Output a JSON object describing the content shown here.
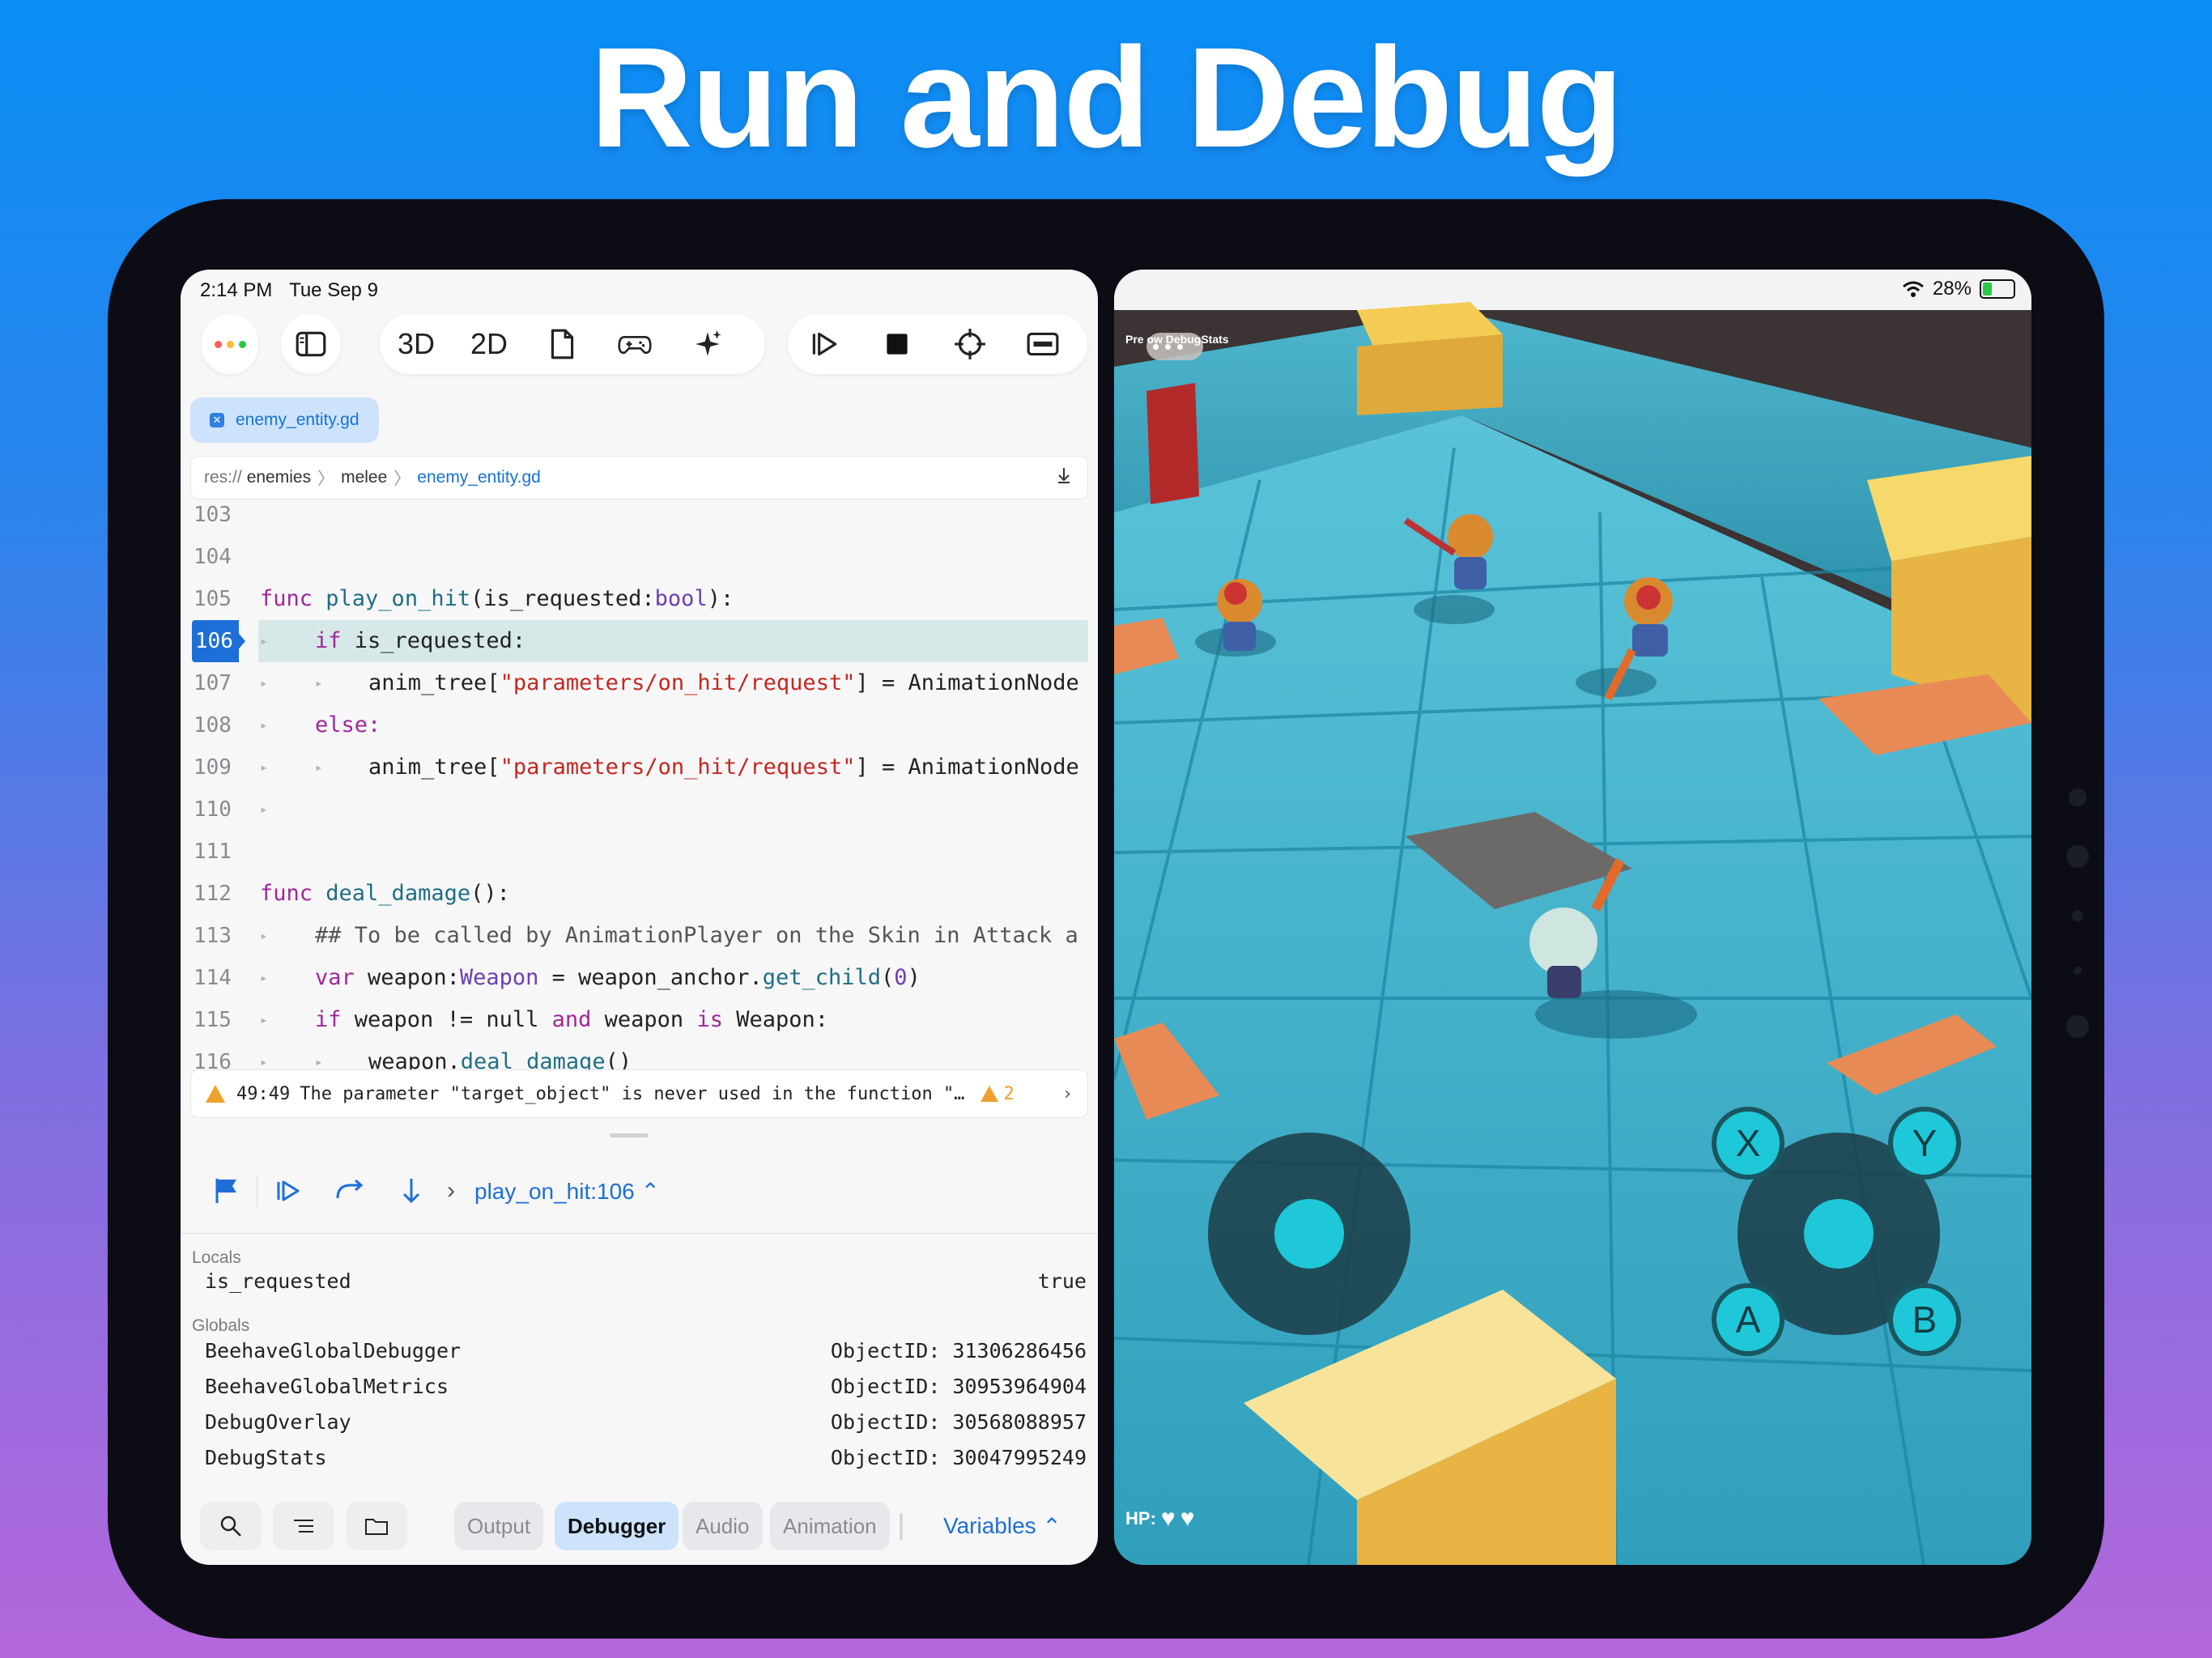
{
  "headline": "Run and Debug",
  "left_status": {
    "time": "2:14 PM",
    "date": "Tue Sep 9"
  },
  "right_status": {
    "battery": "28%"
  },
  "toolbar": {
    "btn_3d": "3D",
    "btn_2d": "2D"
  },
  "tab": {
    "label": "enemy_entity.gd"
  },
  "breadcrumb": {
    "root": "res://",
    "p1": "enemies",
    "p2": "melee",
    "file": "enemy_entity.gd"
  },
  "code": {
    "lines": [
      {
        "no": "103"
      },
      {
        "no": "104"
      },
      {
        "no": "105"
      },
      {
        "no": "106"
      },
      {
        "no": "107"
      },
      {
        "no": "108"
      },
      {
        "no": "109"
      },
      {
        "no": "110"
      },
      {
        "no": "111"
      },
      {
        "no": "112"
      },
      {
        "no": "113"
      },
      {
        "no": "114"
      },
      {
        "no": "115"
      },
      {
        "no": "116"
      }
    ],
    "t105_a": "func ",
    "t105_b": "play_on_hit",
    "t105_c": "(is_requested:",
    "t105_d": "bool",
    "t105_e": "):",
    "t106_a": "if",
    "t106_b": " is_requested:",
    "t107_a": "anim_tree[",
    "t107_b": "\"parameters/on_hit/request\"",
    "t107_c": "] = AnimationNode",
    "t108": "else:",
    "t109_a": "anim_tree[",
    "t109_b": "\"parameters/on_hit/request\"",
    "t109_c": "] = AnimationNode",
    "t112_a": "func ",
    "t112_b": "deal_damage",
    "t112_c": "():",
    "t113": "## To be called by AnimationPlayer on the Skin in Attack a",
    "t114_a": "var",
    "t114_b": " weapon:",
    "t114_c": "Weapon",
    "t114_d": " = weapon_anchor.",
    "t114_e": "get_child",
    "t114_f": "(",
    "t114_g": "0",
    "t114_h": ")",
    "t115_a": "if",
    "t115_b": " weapon != null ",
    "t115_c": "and",
    "t115_d": " weapon ",
    "t115_e": "is",
    "t115_f": " Weapon:",
    "t116_a": "weapon.",
    "t116_b": "deal_damage",
    "t116_c": "()"
  },
  "diagnostic": {
    "pos": "49:49",
    "message": "The parameter \"target_object\" is never used in the function \"…",
    "count": "2"
  },
  "debugger": {
    "frame": "play_on_hit:106"
  },
  "locals": {
    "title": "Locals",
    "items": [
      {
        "name": "is_requested",
        "value": "true"
      }
    ]
  },
  "globals": {
    "title": "Globals",
    "items": [
      {
        "name": "BeehaveGlobalDebugger",
        "value": "ObjectID: 31306286456"
      },
      {
        "name": "BeehaveGlobalMetrics",
        "value": "ObjectID: 30953964904"
      },
      {
        "name": "DebugOverlay",
        "value": "ObjectID: 30568088957"
      },
      {
        "name": "DebugStats",
        "value": "ObjectID: 30047995249"
      }
    ]
  },
  "bottom_tabs": {
    "output": "Output",
    "debugger": "Debugger",
    "audio": "Audio",
    "animation": "Animation",
    "variables": "Variables"
  },
  "game": {
    "overlay_text": "Pre     ow DebugStats",
    "hp_label": "HP:",
    "buttons": {
      "x": "X",
      "y": "Y",
      "a": "A",
      "b": "B"
    }
  },
  "colors": {
    "accent": "#1d6fd7",
    "breakpoint": "#1d6fd7",
    "warning": "#f0a02c",
    "joystick": "#1ec8d8"
  }
}
